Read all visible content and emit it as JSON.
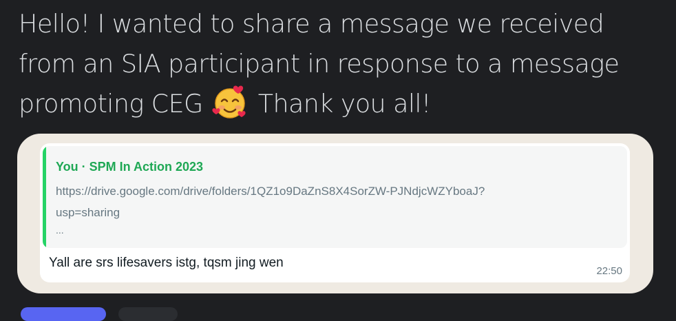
{
  "message": {
    "lines": [
      "Hello! I wanted to share a message we received",
      "from an SIA participant in response to a message",
      "promoting CEG",
      "Thank you all!"
    ],
    "emoji": "smiling-face-with-hearts-icon"
  },
  "attachment": {
    "quote": {
      "title": "You · SPM In Action 2023",
      "link_line1": "https://drive.google.com/drive/folders/1QZ1o9DaZnS8X4SorZW-PJNdjcWZYboaJ?",
      "link_line2": "usp=sharing",
      "ellipsis": "..."
    },
    "reply": "Yall are srs lifesavers istg, tqsm jing wen",
    "time": "22:50"
  },
  "colors": {
    "background": "#1e1f22",
    "text": "#dbdee1",
    "quote_accent": "#25d366",
    "quote_title": "#1fa855",
    "chat_wallpaper": "#efeae2"
  }
}
